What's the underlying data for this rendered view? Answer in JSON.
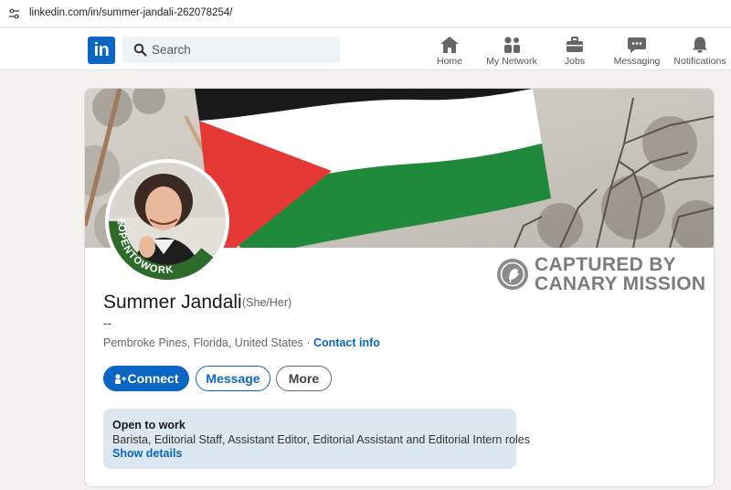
{
  "browser": {
    "url": "linkedin.com/in/summer-jandali-262078254/",
    "site_icon": "site-settings-icon"
  },
  "nav": {
    "logo": "in",
    "search_placeholder": "Search",
    "items": [
      {
        "label": "Home",
        "icon": "home-icon"
      },
      {
        "label": "My Network",
        "icon": "network-icon"
      },
      {
        "label": "Jobs",
        "icon": "briefcase-icon"
      },
      {
        "label": "Messaging",
        "icon": "chat-icon"
      },
      {
        "label": "Notifications",
        "icon": "bell-icon"
      }
    ]
  },
  "profile": {
    "badge": "#OPENTOWORK",
    "name": "Summer Jandali",
    "pronouns": "(She/Her)",
    "headline": "--",
    "location": "Pembroke Pines, Florida, United States",
    "separator": "·",
    "contact_info": "Contact info",
    "watermark": {
      "line1": "CAPTURED BY",
      "line2": "CANARY MISSION"
    },
    "buttons": {
      "connect": "Connect",
      "message": "Message",
      "more": "More"
    },
    "open_to_work": {
      "title": "Open to work",
      "roles": "Barista, Editorial Staff, Assistant Editor, Editorial Assistant and Editorial Intern roles",
      "link": "Show details"
    }
  },
  "colors": {
    "accent": "#0a66c2",
    "otw_green": "#2e6b2a",
    "page_bg": "#f4f2ee"
  }
}
